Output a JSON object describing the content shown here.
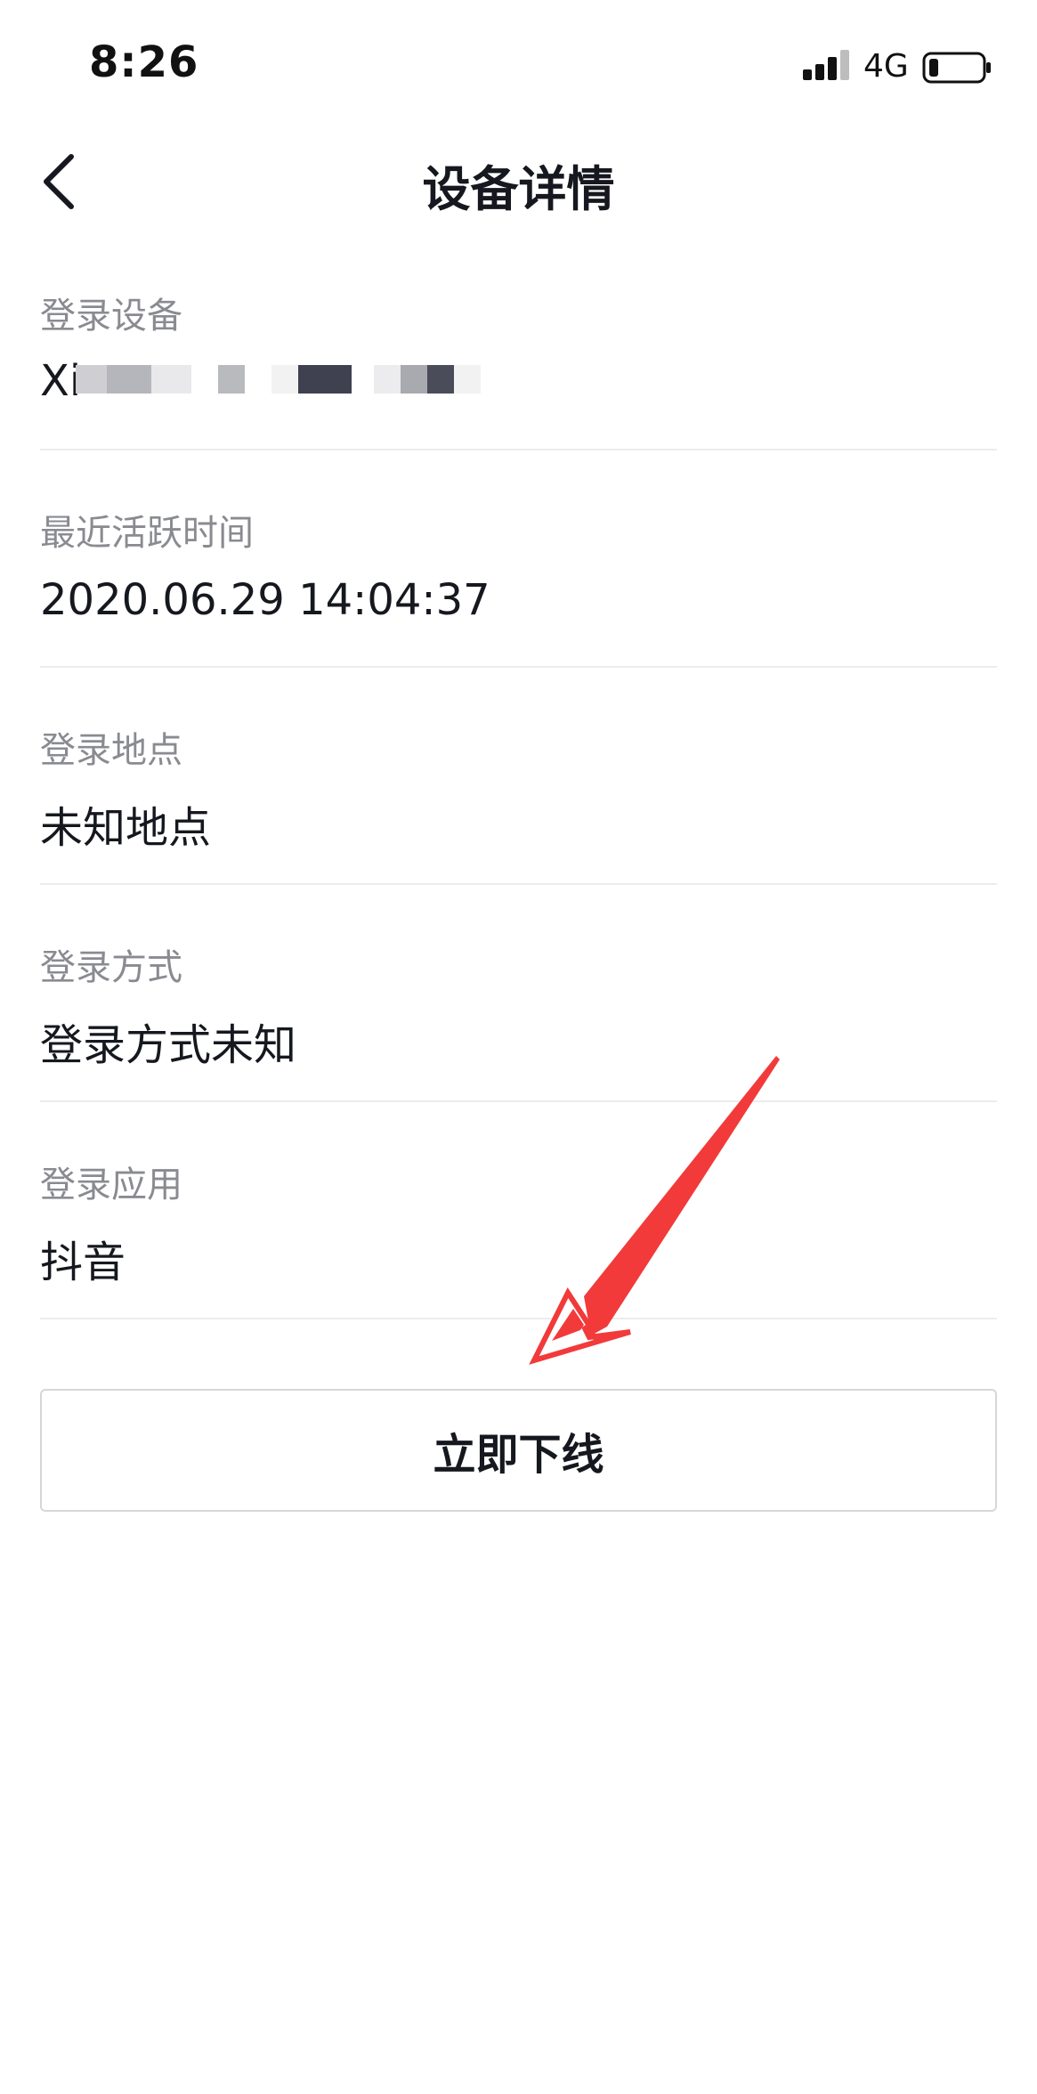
{
  "status_bar": {
    "time": "8:26",
    "network": "4G",
    "signal_icon": "signal-bars-icon",
    "battery_icon": "battery-low-icon"
  },
  "header": {
    "back_icon": "chevron-left-icon",
    "title": "设备详情"
  },
  "items": [
    {
      "label": "登录设备",
      "value": "Xi"
    },
    {
      "label": "最近活跃时间",
      "value": "2020.06.29 14:04:37"
    },
    {
      "label": "登录地点",
      "value": "未知地点"
    },
    {
      "label": "登录方式",
      "value": "登录方式未知"
    },
    {
      "label": "登录应用",
      "value": "抖音"
    }
  ],
  "offline_button": {
    "label": "立即下线"
  },
  "colors": {
    "label_gray": "#8a8b91",
    "text_dark": "#16181f",
    "divider": "#ececee",
    "arrow_red": "#f23a3a"
  }
}
